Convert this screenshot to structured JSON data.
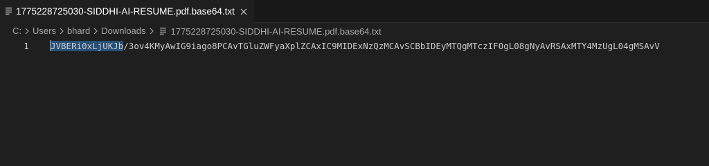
{
  "tab": {
    "title": "1775228725030-SIDDHI-AI-RESUME.pdf.base64.txt",
    "close_icon": "close-icon",
    "file_icon": "text-file-icon"
  },
  "breadcrumb": {
    "drive": "C:",
    "users": "Users",
    "user": "bhard",
    "folder": "Downloads",
    "file": "1775228725030-SIDDHI-AI-RESUME.pdf.base64.txt",
    "separator_icon": "chevron-right-icon"
  },
  "editor": {
    "line_number": "1",
    "selected_text": "JVBERi0xLjUKJb",
    "rest_text": "/3ov4KMyAwIG9iago8PCAvTGluZWFyaXplZCAxIC9MIDExNzQzMCAvSCBbIDEyMTQgMTczIF0gL08gNyAvRSAxMTY4MzUgL04gMSAvV"
  },
  "colors": {
    "background": "#1f1f1f",
    "tabbar": "#181818",
    "selection": "#264f78",
    "text": "#cccccc"
  }
}
